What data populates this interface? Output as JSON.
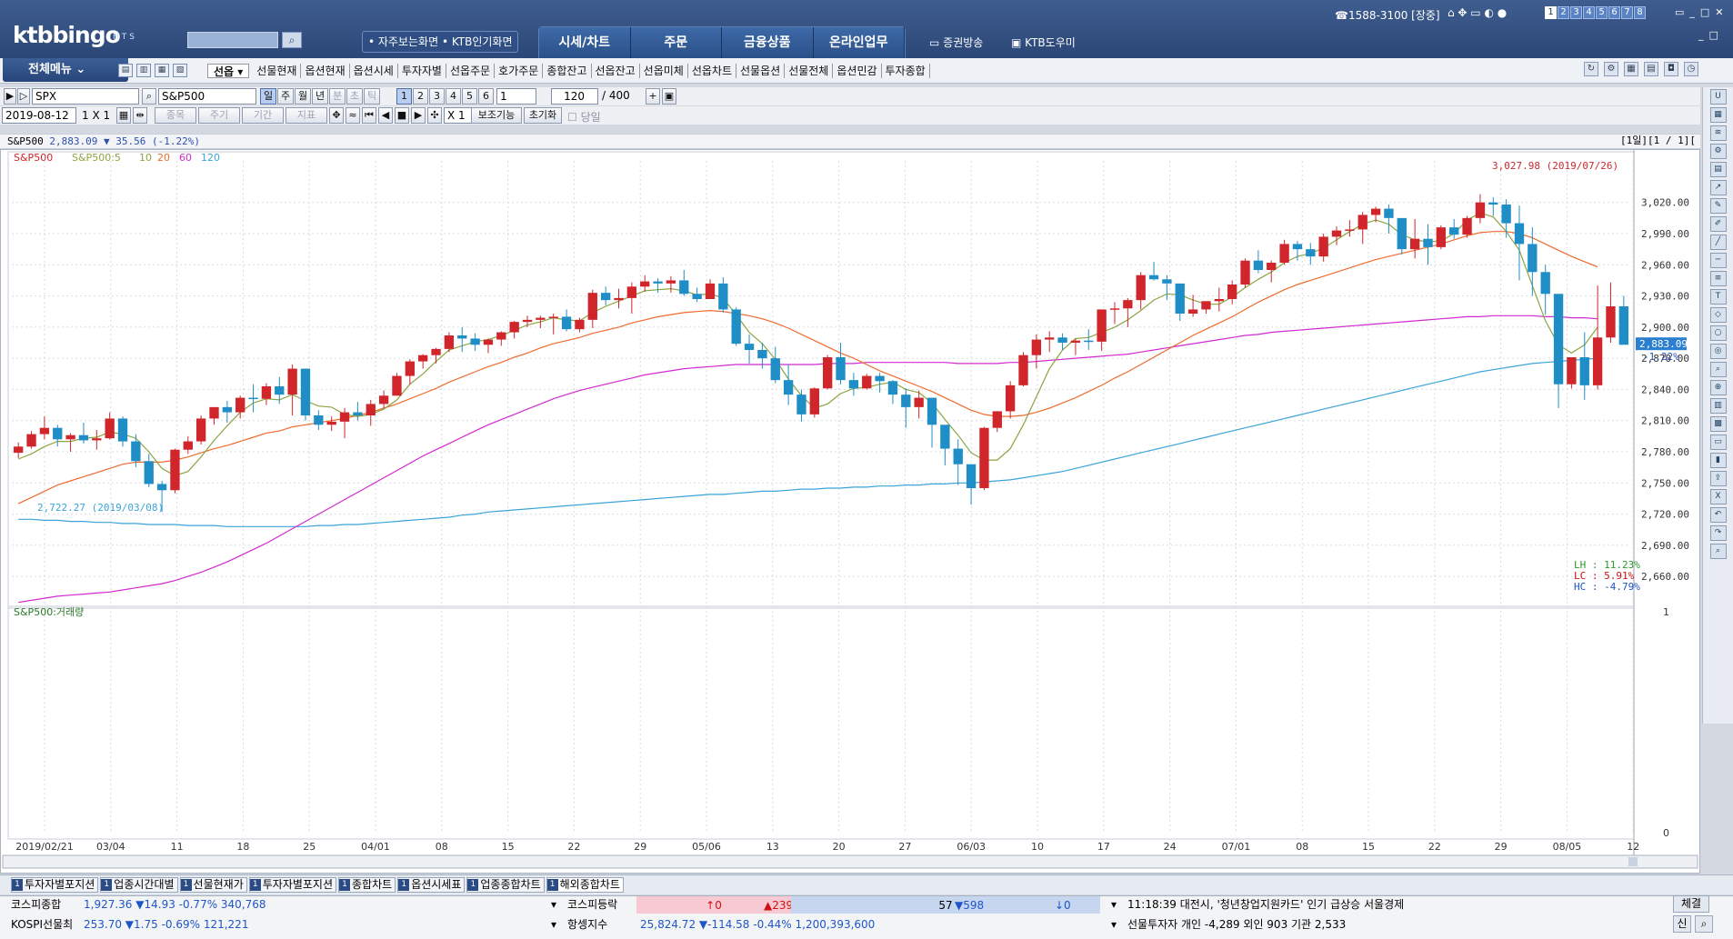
{
  "header": {
    "logo": "ktbbingo",
    "logo_sub": "HTS",
    "quick_links": "• 자주보는화면  • KTB인기화면",
    "nav": [
      "시세/차트",
      "주문",
      "금융상품",
      "온라인업무"
    ],
    "broadcast": "증권방송",
    "ktb_domi": "KTB도우미",
    "phone": "☎1588-3100 [장중]",
    "page_numbers": [
      "1",
      "2",
      "3",
      "4",
      "5",
      "6",
      "7",
      "8"
    ]
  },
  "menu": {
    "all_menu": "전체메뉴",
    "tabs": [
      "선옵",
      "선물현재",
      "옵션현재",
      "옵션시세",
      "투자자별",
      "선옵주문",
      "호가주문",
      "종합잔고",
      "선옵잔고",
      "선옵미체",
      "선옵차트",
      "선물옵션",
      "선물전체",
      "옵션민감",
      "투자종합"
    ]
  },
  "toolbar": {
    "code": "SPX",
    "name": "S&P500",
    "periods": [
      "일",
      "주",
      "월",
      "년",
      "분",
      "초",
      "틱"
    ],
    "numbers": [
      "1",
      "2",
      "3",
      "4",
      "5",
      "6"
    ],
    "unit": "1",
    "count": "120",
    "total": "/ 400",
    "date": "2019-08-12",
    "layout": "1 X 1",
    "tags": [
      "종목",
      "주기",
      "기간",
      "지표"
    ],
    "zoom": "X 1",
    "aux": "보조기능",
    "reset": "초기화",
    "today": "당일"
  },
  "info": {
    "symbol": "S&P500",
    "price": "2,883.09",
    "change": "▼ 35.56 (-1.22%)",
    "right": "[1일][1 / 1][",
    "legend_name": "S&P500",
    "legend_ma": "S&P500:5",
    "legend_10": "10",
    "legend_20": "20",
    "legend_60": "60",
    "legend_120": "120",
    "volume_label": "S&P500:거래량",
    "high_annot": "3,027.98 (2019/07/26)",
    "low_annot": "2,722.27 (2019/03/08)",
    "price_tag": "2,883.09",
    "pct_tag": "-1.22%",
    "lh": "LH : 11.23%",
    "lc": "LC :  5.91%",
    "hc": "HC : -4.79%",
    "vol_top": "1",
    "vol_bottom": "0"
  },
  "chart_data": {
    "type": "candlestick",
    "y_ticks": [
      3020,
      2990,
      2960,
      2930,
      2900,
      2870,
      2840,
      2810,
      2780,
      2750,
      2720,
      2690,
      2660
    ],
    "y_tick_labels": [
      "3,020.00",
      "2,990.00",
      "2,960.00",
      "2,930.00",
      "2,900.00",
      "2,870.00",
      "2,840.00",
      "2,810.00",
      "2,780.00",
      "2,750.00",
      "2,720.00",
      "2,690.00",
      "2,660.00"
    ],
    "ylim": [
      2633,
      3060
    ],
    "x_labels": [
      "2019/02/21",
      "03/04",
      "11",
      "18",
      "25",
      "04/01",
      "08",
      "15",
      "22",
      "29",
      "05/06",
      "13",
      "20",
      "27",
      "06/03",
      "10",
      "17",
      "24",
      "07/01",
      "08",
      "15",
      "22",
      "29",
      "08/05",
      "12"
    ],
    "candles": [
      [
        2779,
        2789,
        2774,
        2785
      ],
      [
        2785,
        2800,
        2783,
        2797
      ],
      [
        2797,
        2814,
        2792,
        2803
      ],
      [
        2803,
        2806,
        2785,
        2792
      ],
      [
        2792,
        2798,
        2780,
        2796
      ],
      [
        2796,
        2808,
        2788,
        2791
      ],
      [
        2791,
        2801,
        2782,
        2793
      ],
      [
        2793,
        2818,
        2792,
        2812
      ],
      [
        2812,
        2814,
        2785,
        2790
      ],
      [
        2790,
        2797,
        2765,
        2771
      ],
      [
        2771,
        2778,
        2746,
        2749
      ],
      [
        2749,
        2752,
        2722,
        2743
      ],
      [
        2743,
        2783,
        2740,
        2782
      ],
      [
        2782,
        2795,
        2778,
        2790
      ],
      [
        2790,
        2815,
        2787,
        2812
      ],
      [
        2812,
        2823,
        2806,
        2823
      ],
      [
        2823,
        2829,
        2808,
        2818
      ],
      [
        2818,
        2834,
        2812,
        2832
      ],
      [
        2832,
        2845,
        2818,
        2831
      ],
      [
        2831,
        2846,
        2825,
        2843
      ],
      [
        2843,
        2852,
        2826,
        2835
      ],
      [
        2835,
        2864,
        2815,
        2860
      ],
      [
        2860,
        2860,
        2810,
        2815
      ],
      [
        2815,
        2820,
        2801,
        2806
      ],
      [
        2806,
        2814,
        2800,
        2809
      ],
      [
        2809,
        2822,
        2793,
        2818
      ],
      [
        2818,
        2828,
        2810,
        2815
      ],
      [
        2815,
        2830,
        2805,
        2826
      ],
      [
        2826,
        2839,
        2822,
        2834
      ],
      [
        2834,
        2856,
        2834,
        2853
      ],
      [
        2853,
        2869,
        2845,
        2867
      ],
      [
        2867,
        2874,
        2860,
        2873
      ],
      [
        2873,
        2880,
        2865,
        2879
      ],
      [
        2879,
        2895,
        2876,
        2892
      ],
      [
        2892,
        2900,
        2876,
        2889
      ],
      [
        2889,
        2894,
        2877,
        2883
      ],
      [
        2883,
        2889,
        2875,
        2888
      ],
      [
        2888,
        2896,
        2882,
        2895
      ],
      [
        2895,
        2906,
        2889,
        2905
      ],
      [
        2905,
        2911,
        2900,
        2907
      ],
      [
        2907,
        2911,
        2899,
        2909
      ],
      [
        2909,
        2913,
        2893,
        2910
      ],
      [
        2910,
        2917,
        2896,
        2898
      ],
      [
        2898,
        2909,
        2895,
        2907
      ],
      [
        2907,
        2936,
        2899,
        2933
      ],
      [
        2933,
        2939,
        2921,
        2926
      ],
      [
        2926,
        2937,
        2918,
        2928
      ],
      [
        2928,
        2943,
        2913,
        2939
      ],
      [
        2939,
        2950,
        2934,
        2944
      ],
      [
        2944,
        2947,
        2933,
        2942
      ],
      [
        2942,
        2949,
        2933,
        2945
      ],
      [
        2945,
        2955,
        2930,
        2932
      ],
      [
        2932,
        2938,
        2924,
        2927
      ],
      [
        2927,
        2946,
        2928,
        2942
      ],
      [
        2942,
        2948,
        2914,
        2917
      ],
      [
        2917,
        2919,
        2882,
        2884
      ],
      [
        2884,
        2893,
        2865,
        2878
      ],
      [
        2878,
        2885,
        2860,
        2870
      ],
      [
        2870,
        2881,
        2846,
        2849
      ],
      [
        2849,
        2864,
        2825,
        2835
      ],
      [
        2835,
        2840,
        2809,
        2816
      ],
      [
        2816,
        2842,
        2813,
        2841
      ],
      [
        2841,
        2873,
        2840,
        2871
      ],
      [
        2871,
        2885,
        2845,
        2849
      ],
      [
        2849,
        2856,
        2834,
        2841
      ],
      [
        2841,
        2855,
        2840,
        2853
      ],
      [
        2853,
        2856,
        2837,
        2848
      ],
      [
        2848,
        2849,
        2826,
        2835
      ],
      [
        2835,
        2841,
        2803,
        2823
      ],
      [
        2823,
        2839,
        2812,
        2832
      ],
      [
        2832,
        2830,
        2784,
        2806
      ],
      [
        2806,
        2790,
        2767,
        2783
      ],
      [
        2783,
        2792,
        2748,
        2768
      ],
      [
        2768,
        2764,
        2729,
        2745
      ],
      [
        2745,
        2804,
        2743,
        2803
      ],
      [
        2803,
        2819,
        2799,
        2819
      ],
      [
        2819,
        2848,
        2812,
        2844
      ],
      [
        2844,
        2876,
        2843,
        2873
      ],
      [
        2873,
        2893,
        2860,
        2888
      ],
      [
        2888,
        2896,
        2876,
        2890
      ],
      [
        2890,
        2894,
        2878,
        2885
      ],
      [
        2885,
        2889,
        2873,
        2887
      ],
      [
        2887,
        2898,
        2878,
        2886
      ],
      [
        2886,
        2906,
        2877,
        2917
      ],
      [
        2917,
        2924,
        2903,
        2918
      ],
      [
        2918,
        2928,
        2900,
        2926
      ],
      [
        2926,
        2953,
        2917,
        2950
      ],
      [
        2950,
        2963,
        2945,
        2946
      ],
      [
        2946,
        2950,
        2926,
        2942
      ],
      [
        2942,
        2941,
        2906,
        2913
      ],
      [
        2913,
        2931,
        2910,
        2917
      ],
      [
        2917,
        2922,
        2913,
        2925
      ],
      [
        2925,
        2938,
        2915,
        2927
      ],
      [
        2927,
        2945,
        2922,
        2941
      ],
      [
        2941,
        2966,
        2938,
        2964
      ],
      [
        2964,
        2974,
        2952,
        2955
      ],
      [
        2955,
        2964,
        2943,
        2962
      ],
      [
        2962,
        2984,
        2960,
        2980
      ],
      [
        2980,
        2983,
        2964,
        2975
      ],
      [
        2975,
        2981,
        2960,
        2968
      ],
      [
        2968,
        2990,
        2963,
        2987
      ],
      [
        2987,
        2997,
        2979,
        2993
      ],
      [
        2993,
        3003,
        2987,
        2994
      ],
      [
        2994,
        3011,
        2980,
        3008
      ],
      [
        3008,
        3016,
        3001,
        3014
      ],
      [
        3014,
        3018,
        2990,
        3005
      ],
      [
        3005,
        2995,
        2970,
        2975
      ],
      [
        2975,
        3004,
        2966,
        2985
      ],
      [
        2985,
        2999,
        2960,
        2977
      ],
      [
        2977,
        2998,
        2975,
        2996
      ],
      [
        2996,
        3004,
        2985,
        2989
      ],
      [
        2989,
        3007,
        2986,
        3005
      ],
      [
        3005,
        3028,
        3000,
        3020
      ],
      [
        3020,
        3025,
        3007,
        3018
      ],
      [
        3018,
        3023,
        2986,
        3000
      ],
      [
        3000,
        3017,
        2945,
        2980
      ],
      [
        2980,
        2996,
        2930,
        2953
      ],
      [
        2953,
        2960,
        2912,
        2932
      ],
      [
        2932,
        2883,
        2822,
        2845
      ],
      [
        2845,
        2858,
        2841,
        2871
      ],
      [
        2871,
        2895,
        2830,
        2844
      ],
      [
        2844,
        2940,
        2840,
        2890
      ],
      [
        2890,
        2943,
        2885,
        2920
      ],
      [
        2920,
        2930,
        2908,
        2883
      ]
    ],
    "ma5": [
      2773,
      2778,
      2785,
      2790,
      2790,
      2793,
      2794,
      2799,
      2797,
      2793,
      2780,
      2764,
      2757,
      2761,
      2775,
      2791,
      2805,
      2818,
      2827,
      2831,
      2830,
      2835,
      2829,
      2824,
      2823,
      2816,
      2814,
      2816,
      2821,
      2830,
      2845,
      2855,
      2867,
      2878,
      2882,
      2886,
      2888,
      2892,
      2897,
      2902,
      2905,
      2909,
      2907,
      2906,
      2914,
      2920,
      2925,
      2930,
      2935,
      2936,
      2937,
      2935,
      2931,
      2932,
      2928,
      2912,
      2895,
      2884,
      2869,
      2850,
      2834,
      2822,
      2826,
      2836,
      2841,
      2842,
      2845,
      2847,
      2840,
      2837,
      2827,
      2811,
      2796,
      2779,
      2772,
      2772,
      2783,
      2806,
      2833,
      2860,
      2878,
      2889,
      2890,
      2895,
      2900,
      2907,
      2916,
      2926,
      2932,
      2931,
      2926,
      2922,
      2922,
      2929,
      2938,
      2946,
      2953,
      2962,
      2968,
      2971,
      2976,
      2984,
      2992,
      2999,
      3003,
      2999,
      2989,
      2984,
      2982,
      2983,
      2990,
      3003,
      3010,
      3006,
      2992,
      2974,
      2940,
      2906,
      2883,
      2875,
      2883,
      2900
    ],
    "ma20": [
      2730,
      2736,
      2742,
      2748,
      2752,
      2756,
      2760,
      2764,
      2768,
      2770,
      2770,
      2770,
      2772,
      2775,
      2779,
      2783,
      2786,
      2790,
      2794,
      2798,
      2800,
      2804,
      2806,
      2808,
      2810,
      2812,
      2815,
      2818,
      2822,
      2826,
      2831,
      2836,
      2841,
      2847,
      2852,
      2857,
      2862,
      2866,
      2871,
      2875,
      2880,
      2884,
      2887,
      2890,
      2894,
      2897,
      2900,
      2904,
      2907,
      2910,
      2912,
      2914,
      2915,
      2916,
      2915,
      2913,
      2911,
      2908,
      2904,
      2899,
      2893,
      2887,
      2881,
      2875,
      2870,
      2864,
      2858,
      2853,
      2848,
      2843,
      2838,
      2832,
      2826,
      2820,
      2816,
      2814,
      2814,
      2815,
      2818,
      2822,
      2827,
      2832,
      2838,
      2844,
      2851,
      2857,
      2864,
      2871,
      2878,
      2885,
      2892,
      2898,
      2904,
      2910,
      2917,
      2924,
      2930,
      2936,
      2941,
      2945,
      2949,
      2953,
      2957,
      2961,
      2965,
      2968,
      2971,
      2974,
      2977,
      2980,
      2984,
      2988,
      2991,
      2992,
      2992,
      2990,
      2986,
      2980,
      2974,
      2968,
      2963,
      2958
    ],
    "ma60": [
      2635,
      2637,
      2639,
      2641,
      2642,
      2643,
      2644,
      2645,
      2647,
      2649,
      2651,
      2653,
      2656,
      2660,
      2664,
      2669,
      2674,
      2680,
      2686,
      2692,
      2699,
      2706,
      2713,
      2720,
      2727,
      2734,
      2741,
      2748,
      2755,
      2762,
      2769,
      2776,
      2782,
      2788,
      2794,
      2800,
      2806,
      2811,
      2816,
      2821,
      2826,
      2831,
      2835,
      2839,
      2842,
      2845,
      2848,
      2851,
      2854,
      2856,
      2858,
      2860,
      2861,
      2862,
      2863,
      2864,
      2864,
      2864,
      2864,
      2864,
      2864,
      2864,
      2865,
      2865,
      2865,
      2866,
      2866,
      2866,
      2866,
      2866,
      2866,
      2866,
      2865,
      2865,
      2865,
      2865,
      2866,
      2866,
      2867,
      2868,
      2869,
      2870,
      2871,
      2872,
      2873,
      2874,
      2876,
      2878,
      2880,
      2882,
      2884,
      2886,
      2888,
      2890,
      2892,
      2893,
      2895,
      2896,
      2897,
      2898,
      2899,
      2900,
      2901,
      2902,
      2903,
      2904,
      2905,
      2906,
      2907,
      2908,
      2909,
      2910,
      2910,
      2911,
      2911,
      2911,
      2911,
      2910,
      2910,
      2909,
      2909,
      2908
    ],
    "ma120": [
      2715,
      2715,
      2714,
      2714,
      2713,
      2713,
      2712,
      2712,
      2711,
      2711,
      2710,
      2710,
      2710,
      2709,
      2709,
      2709,
      2708,
      2708,
      2708,
      2708,
      2708,
      2708,
      2708,
      2709,
      2709,
      2710,
      2710,
      2711,
      2712,
      2713,
      2714,
      2715,
      2716,
      2717,
      2719,
      2720,
      2722,
      2723,
      2724,
      2725,
      2726,
      2727,
      2728,
      2729,
      2730,
      2731,
      2732,
      2733,
      2734,
      2735,
      2736,
      2737,
      2738,
      2739,
      2739,
      2740,
      2741,
      2742,
      2742,
      2743,
      2744,
      2744,
      2745,
      2745,
      2746,
      2746,
      2747,
      2747,
      2748,
      2748,
      2749,
      2749,
      2750,
      2750,
      2751,
      2752,
      2753,
      2755,
      2757,
      2759,
      2761,
      2764,
      2767,
      2770,
      2773,
      2776,
      2779,
      2782,
      2785,
      2788,
      2791,
      2794,
      2797,
      2800,
      2803,
      2806,
      2809,
      2812,
      2815,
      2818,
      2821,
      2824,
      2827,
      2830,
      2833,
      2836,
      2839,
      2842,
      2845,
      2848,
      2851,
      2854,
      2857,
      2859,
      2861,
      2863,
      2865,
      2866,
      2867,
      2868,
      2869,
      2870
    ]
  },
  "bottom_tabs": [
    "투자자별포지션",
    "업종시간대별",
    "선물현재가",
    "투자자별포지션",
    "종합차트",
    "옵션시세표",
    "업종종합차트",
    "해외종합차트"
  ],
  "status": {
    "r1_name": "코스피종합",
    "r1_vals": "1,927.36   ▼14.93  -0.77%   340,768",
    "r1_mid_name": "코스피등락",
    "r1_up": "↑0",
    "r1_up2": "▲239",
    "r1_flat": "57",
    "r1_down": "▼598",
    "r1_down2": "↓0",
    "r1_news": "11:18:39 대전시, '청년창업지원카드' 인기 급상승  서울경제",
    "r1_btn": "체결",
    "r2_name": "KOSPI선물최",
    "r2_vals": "253.70   ▼1.75  -0.69%   121,221",
    "r2_mid_name": "항셍지수",
    "r2_mid_vals": "25,824.72   ▼-114.58  -0.44%  1,200,393,600",
    "r2_right": "선물투자자     개인 -4,289  외인 903  기관 2,533",
    "r2_btn": "신"
  },
  "colors": {
    "up": "#d0262b",
    "down": "#1f8ec6",
    "ma5": "#8aa542",
    "ma20": "#ef6b2d",
    "ma60": "#d22ad0",
    "ma120": "#3aa3d8"
  }
}
